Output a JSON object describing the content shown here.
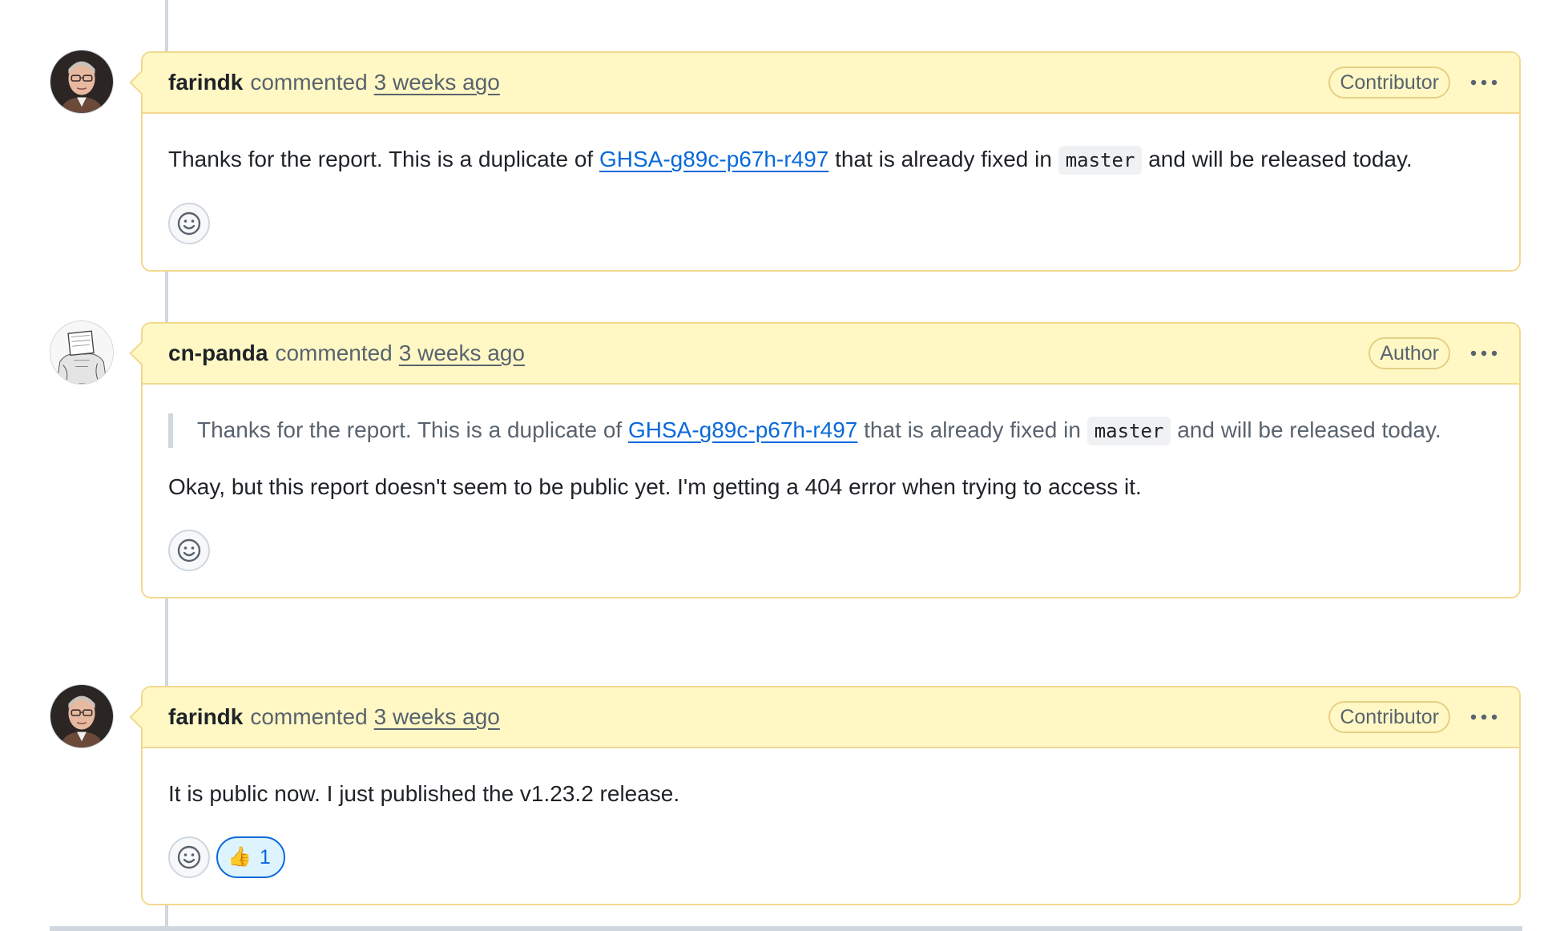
{
  "comments": [
    {
      "author": "farindk",
      "verb": "commented",
      "time": "3 weeks ago",
      "role": "Contributor",
      "body": {
        "before": "Thanks for the report. This is a duplicate of ",
        "link": "GHSA-g89c-p67h-r497",
        "middle": " that is already fixed in ",
        "code": "master",
        "after": " and will be released today."
      }
    },
    {
      "author": "cn-panda",
      "verb": "commented",
      "time": "3 weeks ago",
      "role": "Author",
      "quote": {
        "before": "Thanks for the report. This is a duplicate of ",
        "link": "GHSA-g89c-p67h-r497",
        "middle": " that is already fixed in ",
        "code": "master",
        "after": " and will be released today."
      },
      "body_text": "Okay, but this report doesn't seem to be public yet. I'm getting a 404 error when trying to access it."
    },
    {
      "author": "farindk",
      "verb": "commented",
      "time": "3 weeks ago",
      "role": "Contributor",
      "body_text": "It is public now. I just published the v1.23.2 release.",
      "reaction": {
        "emoji": "👍",
        "count": "1"
      }
    }
  ],
  "icons": {
    "add_reaction": "smiley-icon",
    "menu": "kebab-horizontal-icon"
  },
  "colors": {
    "header_bg": "#fff8c5",
    "header_border": "#f2d98f",
    "link": "#0969da",
    "timeline": "#d0d7de"
  }
}
